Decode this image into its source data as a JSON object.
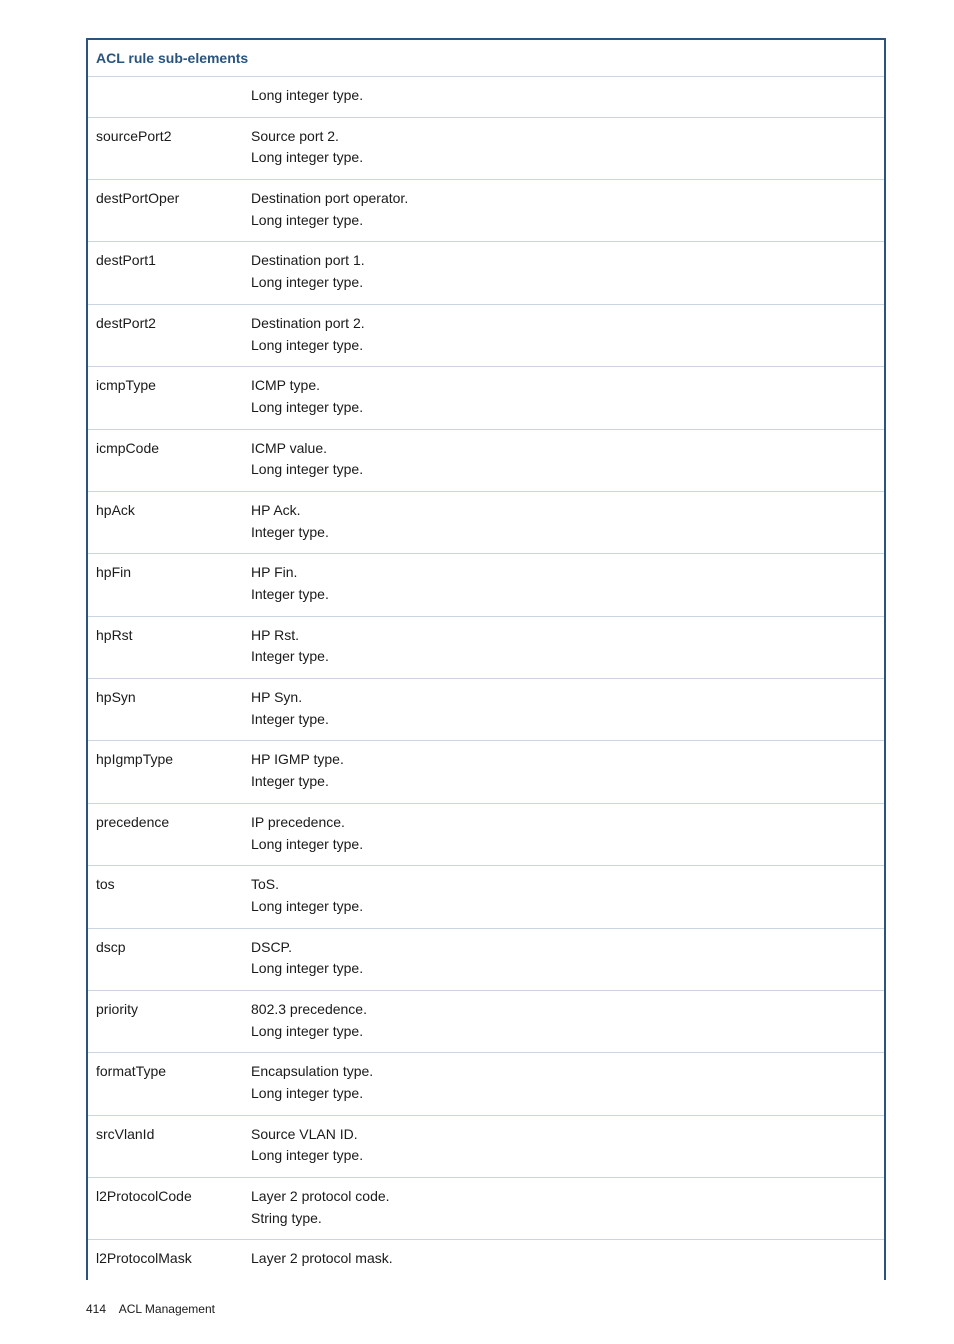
{
  "table": {
    "header": "ACL rule sub-elements",
    "rows": [
      {
        "key": "",
        "desc": [
          "Long integer type."
        ]
      },
      {
        "key": "sourcePort2",
        "desc": [
          "Source port 2.",
          "Long integer type."
        ]
      },
      {
        "key": "destPortOper",
        "desc": [
          "Destination port operator.",
          "Long integer type."
        ]
      },
      {
        "key": "destPort1",
        "desc": [
          "Destination port 1.",
          "Long integer type."
        ]
      },
      {
        "key": "destPort2",
        "desc": [
          "Destination port 2.",
          "Long integer type."
        ]
      },
      {
        "key": "icmpType",
        "desc": [
          "ICMP type.",
          "Long integer type."
        ]
      },
      {
        "key": "icmpCode",
        "desc": [
          "ICMP value.",
          "Long integer type."
        ]
      },
      {
        "key": "hpAck",
        "desc": [
          "HP Ack.",
          "Integer type."
        ]
      },
      {
        "key": "hpFin",
        "desc": [
          "HP Fin.",
          "Integer type."
        ]
      },
      {
        "key": "hpRst",
        "desc": [
          "HP Rst.",
          "Integer type."
        ]
      },
      {
        "key": "hpSyn",
        "desc": [
          "HP Syn.",
          "Integer type."
        ]
      },
      {
        "key": "hpIgmpType",
        "desc": [
          "HP IGMP type.",
          "Integer type."
        ]
      },
      {
        "key": "precedence",
        "desc": [
          "IP precedence.",
          "Long integer type."
        ]
      },
      {
        "key": "tos",
        "desc": [
          "ToS.",
          "Long integer type."
        ]
      },
      {
        "key": "dscp",
        "desc": [
          "DSCP.",
          "Long integer type."
        ]
      },
      {
        "key": "priority",
        "desc": [
          "802.3 precedence.",
          "Long integer type."
        ]
      },
      {
        "key": "formatType",
        "desc": [
          "Encapsulation type.",
          "Long integer type."
        ]
      },
      {
        "key": "srcVlanId",
        "desc": [
          "Source VLAN ID.",
          "Long integer type."
        ]
      },
      {
        "key": "l2ProtocolCode",
        "desc": [
          "Layer 2 protocol code.",
          "String type."
        ]
      },
      {
        "key": "l2ProtocolMask",
        "desc": [
          "Layer 2 protocol mask."
        ]
      }
    ]
  },
  "footer": {
    "page": "414",
    "section": "ACL Management"
  }
}
